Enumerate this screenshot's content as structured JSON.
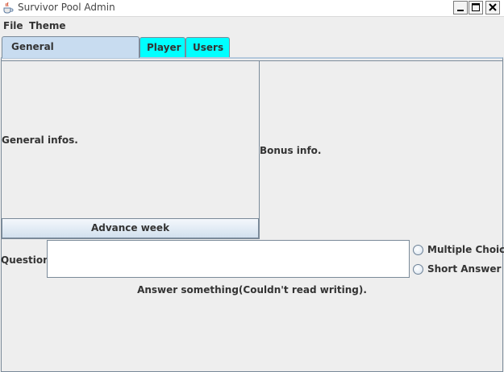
{
  "window": {
    "title": "Survivor Pool Admin",
    "icon": "java-cup-icon",
    "controls": [
      "minimize-icon",
      "maximize-icon",
      "close-icon"
    ]
  },
  "menu": {
    "file": "File",
    "theme": "Theme"
  },
  "tabs": [
    {
      "label": "General",
      "selected": true,
      "color": "#c8dcf0"
    },
    {
      "label": "Player",
      "selected": false,
      "color": "#00ffff"
    },
    {
      "label": "Users",
      "selected": false,
      "color": "#00ffff"
    }
  ],
  "general": {
    "info_label": "General infos.",
    "bonus_label": "Bonus info.",
    "advance_button": "Advance week"
  },
  "question": {
    "label": "Question:",
    "value": "",
    "options": [
      {
        "label": "Multiple Choice",
        "checked": false
      },
      {
        "label": "Short Answer",
        "checked": false
      }
    ],
    "answer_text": "Answer something(Couldn't read writing)."
  }
}
